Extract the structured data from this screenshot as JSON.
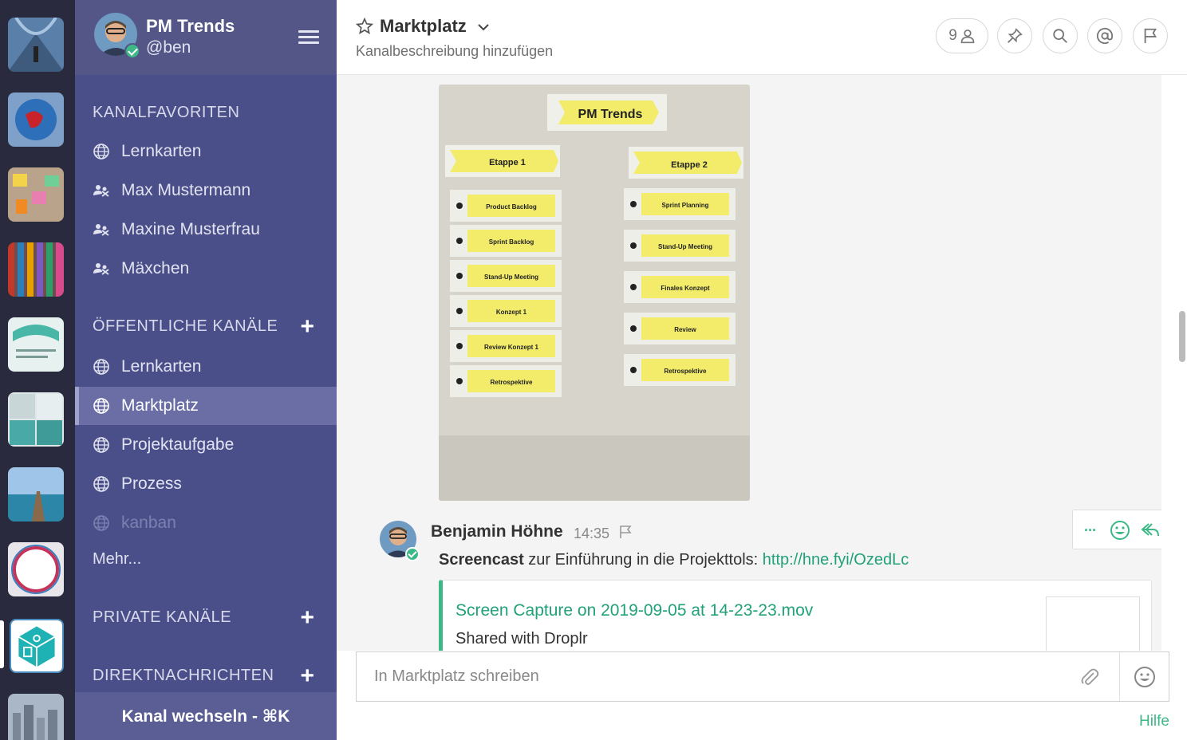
{
  "sidebar": {
    "team_name": "PM Trends",
    "username": "@ben",
    "favorites_heading": "KANALFAVORITEN",
    "favorites": [
      {
        "label": "Lernkarten",
        "icon": "globe-icon"
      },
      {
        "label": "Max Mustermann",
        "icon": "group-icon"
      },
      {
        "label": "Maxine Musterfrau",
        "icon": "group-icon"
      },
      {
        "label": "Mäxchen",
        "icon": "group-icon"
      }
    ],
    "public_heading": "ÖFFENTLICHE KANÄLE",
    "public_channels": [
      {
        "label": "Lernkarten",
        "icon": "globe-icon"
      },
      {
        "label": "Marktplatz",
        "icon": "globe-icon",
        "active": true
      },
      {
        "label": "Projektaufgabe",
        "icon": "globe-icon"
      },
      {
        "label": "Prozess",
        "icon": "globe-icon"
      },
      {
        "label": "kanban",
        "icon": "globe-icon",
        "muted": true
      }
    ],
    "more_label": "Mehr...",
    "private_heading": "PRIVATE KANÄLE",
    "direct_heading": "DIREKTNACHRICHTEN",
    "add_symbol": "+",
    "switch_label": "Kanal wechseln - ⌘K"
  },
  "header": {
    "channel_title": "Marktplatz",
    "channel_description": "Kanalbeschreibung hinzufügen",
    "member_count": "9"
  },
  "photo": {
    "title_card": "PM Trends",
    "stage1": "Etappe 1",
    "stage2": "Etappe 2",
    "cards_left": [
      "Product Backlog",
      "Sprint Backlog",
      "Stand-Up Meeting",
      "Konzept 1",
      "Review Konzept 1",
      "Retrospektive"
    ],
    "cards_right": [
      "Sprint Planning",
      "Stand-Up Meeting",
      "Finales Konzept",
      "Review",
      "Retrospektive"
    ]
  },
  "post": {
    "author": "Benjamin Höhne",
    "time": "14:35",
    "text_bold": "Screencast",
    "text_rest": " zur Einführung in die Projekttols: ",
    "link": "http://hne.fyi/OzedLc",
    "actions_more": "...",
    "embed_title": "Screen Capture on 2019-09-05 at 14-23-23.mov",
    "embed_subtitle": "Shared with Droplr"
  },
  "composer": {
    "placeholder": "In Marktplatz schreiben",
    "help_label": "Hilfe"
  },
  "colors": {
    "accent_green": "#3db887",
    "link_green": "#21a179",
    "sidebar_bg": "#4a4f8a",
    "team_bar_bg": "#2a2a3f"
  }
}
